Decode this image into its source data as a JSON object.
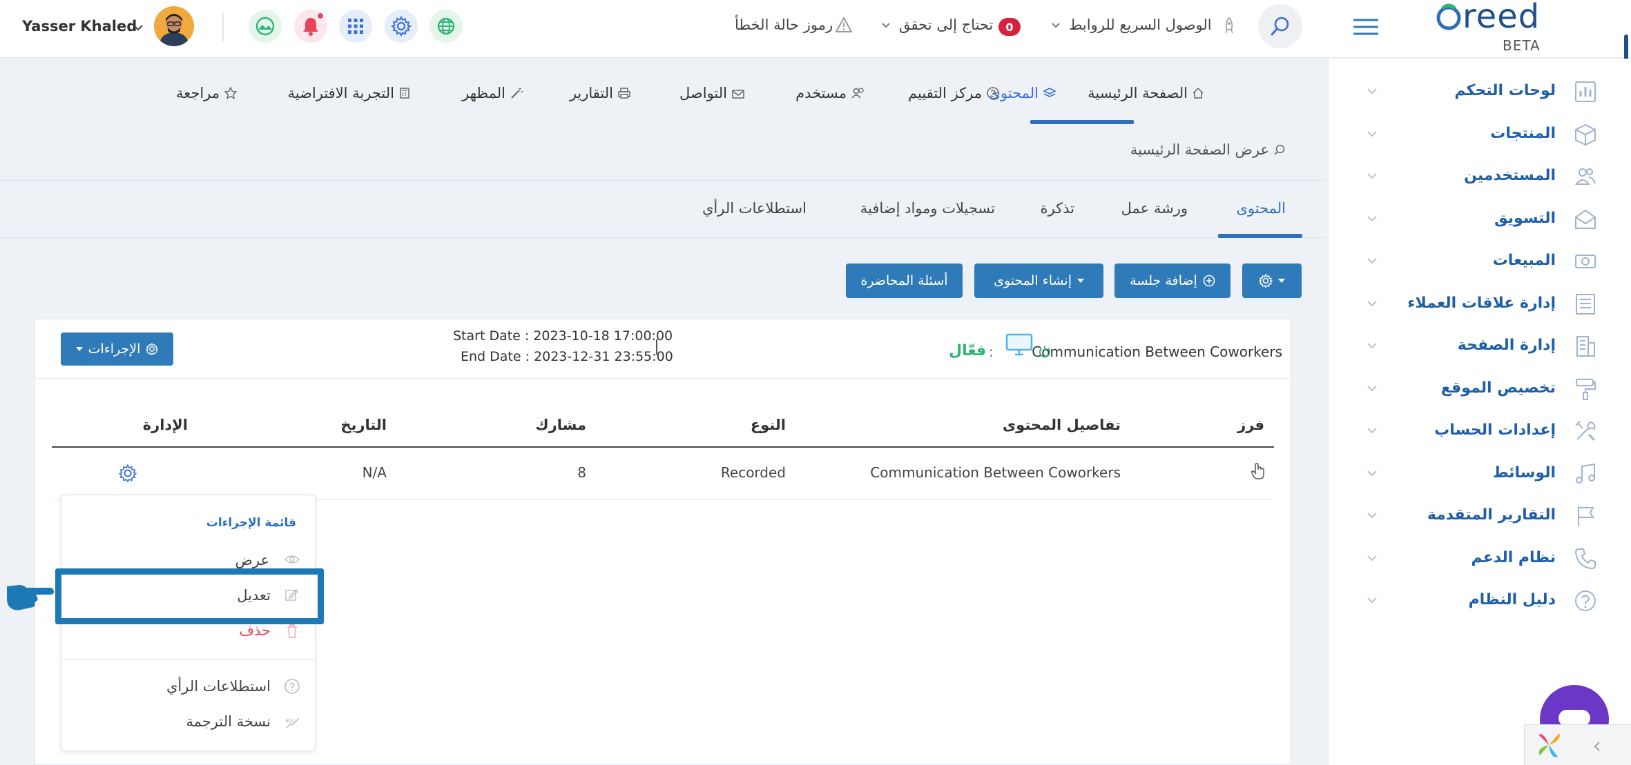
{
  "header": {
    "brand_name": "reed",
    "brand_tag": "BETA",
    "quick_links": "الوصول السريع للروابط",
    "needs_check": "تحتاج إلى تحقق",
    "needs_check_count": "0",
    "error_codes": "رموز حالة الخطأ",
    "user_name": "Yasser Khaled"
  },
  "sidebar": {
    "items": [
      {
        "label": "لوحات التحكم",
        "icon": "dashboard-chart-icon"
      },
      {
        "label": "المنتجات",
        "icon": "box-icon"
      },
      {
        "label": "المستخدمين",
        "icon": "users-icon"
      },
      {
        "label": "التسويق",
        "icon": "envelope-icon"
      },
      {
        "label": "المبيعات",
        "icon": "money-icon"
      },
      {
        "label": "إدارة علاقات العملاء",
        "icon": "crm-icon"
      },
      {
        "label": "إدارة الصفحة",
        "icon": "building-icon"
      },
      {
        "label": "تخصيص الموقع",
        "icon": "paint-roller-icon"
      },
      {
        "label": "إعدادات الحساب",
        "icon": "tools-icon"
      },
      {
        "label": "الوسائط",
        "icon": "music-icon"
      },
      {
        "label": "التقارير المتقدمة",
        "icon": "flag-icon"
      },
      {
        "label": "نظام الدعم",
        "icon": "phone-icon"
      },
      {
        "label": "دليل النظام",
        "icon": "help-icon"
      }
    ]
  },
  "nav": {
    "items": [
      {
        "label": "الصفحة الرئيسية"
      },
      {
        "label": "المحتوى"
      },
      {
        "label": "مركز التقييم"
      },
      {
        "label": "مستخدم"
      },
      {
        "label": "التواصل"
      },
      {
        "label": "التقارير"
      },
      {
        "label": "المظهر"
      },
      {
        "label": "التجربة الافتراضية"
      },
      {
        "label": "مراجعة"
      }
    ],
    "breadcrumb": "عرض الصفحة الرئيسية"
  },
  "tabs": [
    {
      "label": "المحتوى"
    },
    {
      "label": "ورشة عمل"
    },
    {
      "label": "تذكرة"
    },
    {
      "label": "تسجيلات ومواد إضافية"
    },
    {
      "label": "استطلاعات الرأي"
    }
  ],
  "toolbar": {
    "add_session": "إضافة جلسة",
    "create_content": "إنشاء المحتوى",
    "lecture_questions": "أسئلة المحاضرة"
  },
  "session": {
    "title": "Communication Between Coworkers",
    "status_sep": ":",
    "status": "فعّال",
    "start_date": "Start Date : 2023-10-18 17:00:00",
    "end_date": "End Date : 2023-12-31 23:55:00",
    "actions_label": "الإجراءات"
  },
  "table": {
    "headers": {
      "sort": "فرز",
      "details": "تفاصيل المحتوى",
      "type": "النوع",
      "participant": "مشارك",
      "date": "التاريخ",
      "admin": "الإدارة"
    },
    "row": {
      "details": "Communication Between Coworkers",
      "type": "Recorded",
      "participant": "8",
      "date": "N/A"
    }
  },
  "actions_menu": {
    "title": "قائمة الإجراءات",
    "view": "عرض",
    "edit": "تعديل",
    "delete": "حذف",
    "polls": "استطلاعات الرأي",
    "translation": "نسخة الترجمة"
  },
  "colors": {
    "primary": "#2f7ab8",
    "sidebar_text": "#1f5fa7",
    "active_status": "#2bb673",
    "danger": "#e8455b",
    "highlight_box": "#1d78b6"
  }
}
